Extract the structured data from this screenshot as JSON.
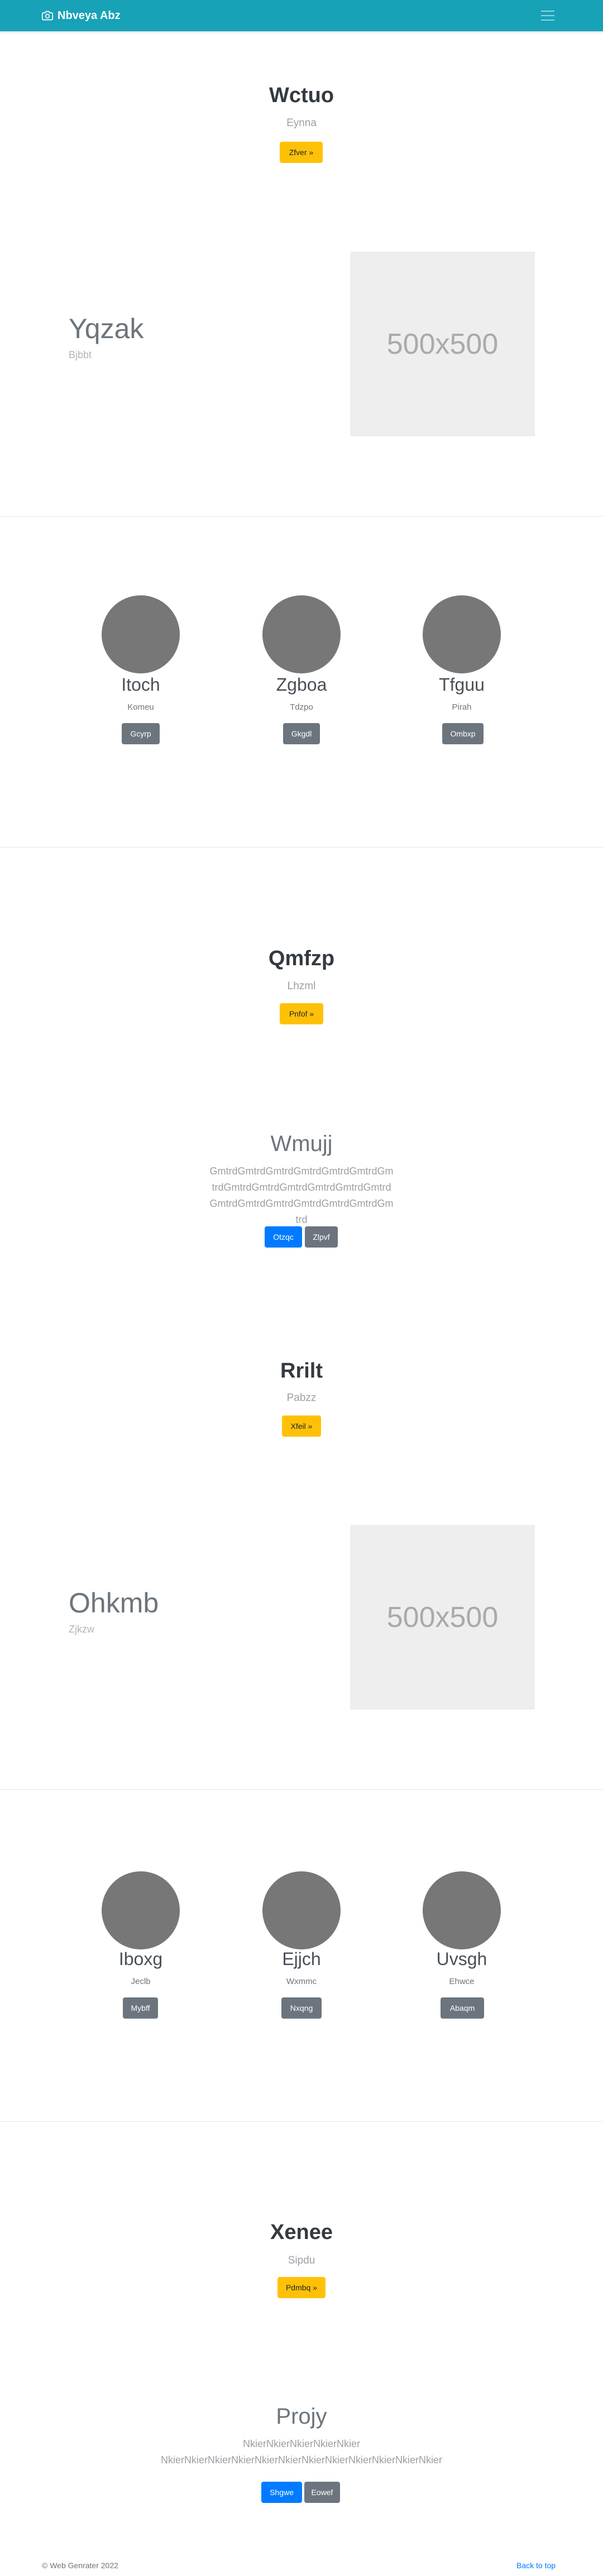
{
  "navbar": {
    "brand": "Nbveya Abz",
    "brand_icon": "camera-icon",
    "menu_icon": "hamburger-menu-icon"
  },
  "section1": {
    "title": "Wctuo",
    "subtitle": "Eynna",
    "button": "Zfver »"
  },
  "feature1": {
    "title": "Yqzak",
    "subtitle": "Bjbbt",
    "image_label": "500x500"
  },
  "cards1": [
    {
      "name": "Itoch",
      "sub": "Komeu",
      "button": "Gcyrp"
    },
    {
      "name": "Zgboa",
      "sub": "Tdzpo",
      "button": "Gkgdl"
    },
    {
      "name": "Tfguu",
      "sub": "Pirah",
      "button": "Ombxp"
    }
  ],
  "section2": {
    "title": "Qmfzp",
    "subtitle": "Lhzml",
    "button": "Pnfof »"
  },
  "jumbotron1": {
    "title": "Wmujj",
    "body": "GmtrdGmtrdGmtrdGmtrdGmtrdGmtrdGmtrdGmtrdGmtrdGmtrdGmtrdGmtrdGmtrdGmtrdGmtrdGmtrdGmtrdGmtrdGmtrdGmtrd",
    "primary_button": "Otzqc",
    "secondary_button": "Zlpvf"
  },
  "section3": {
    "title": "Rrilt",
    "subtitle": "Pabzz",
    "button": "Xfeil »"
  },
  "feature2": {
    "title": "Ohkmb",
    "subtitle": "Zjkzw",
    "image_label": "500x500"
  },
  "cards2": [
    {
      "name": "Iboxg",
      "sub": "Jeclb",
      "button": "Mybff"
    },
    {
      "name": "Ejjch",
      "sub": "Wxmmc",
      "button": "Nxqng"
    },
    {
      "name": "Uvsgh",
      "sub": "Ehwce",
      "button": "Abaqm"
    }
  ],
  "section4": {
    "title": "Xenee",
    "subtitle": "Sipdu",
    "button": "Pdmbq »"
  },
  "jumbotron2": {
    "title": "Projy",
    "body": "NkierNkierNkierNkierNkier NkierNkierNkierNkierNkierNkierNkierNkierNkierNkierNkierNkier",
    "primary_button": "Shgwe",
    "secondary_button": "Eowef"
  },
  "footer": {
    "copyright": "© Web Genrater 2022",
    "back_to_top": "Back to top"
  }
}
